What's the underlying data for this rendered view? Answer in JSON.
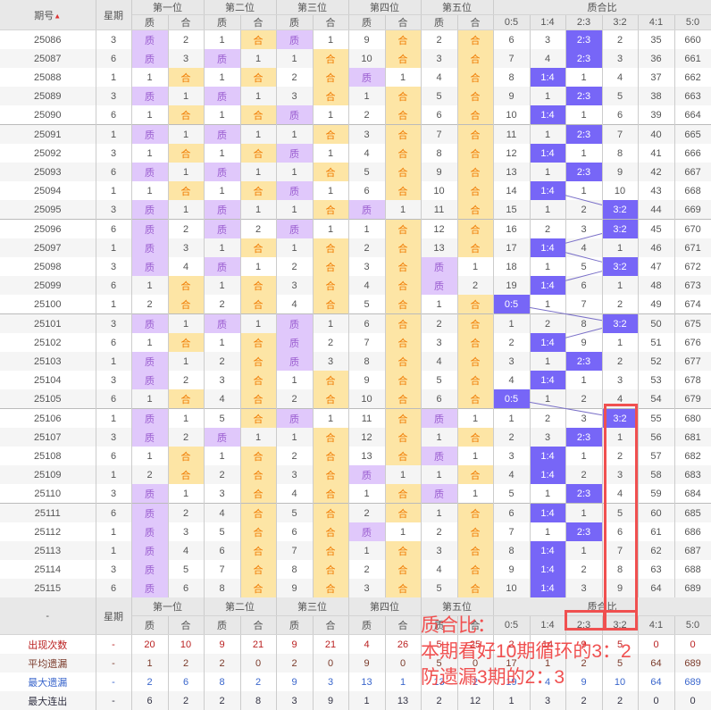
{
  "header": {
    "issue_label": "期号",
    "weekday_label": "星期",
    "positions": [
      "第一位",
      "第二位",
      "第三位",
      "第四位",
      "第五位"
    ],
    "sub_labels": [
      "质",
      "合"
    ],
    "ratio_label": "质合比",
    "ratio_cols": [
      "0:5",
      "1:4",
      "2:3",
      "3:2",
      "4:1",
      "5:0"
    ],
    "footer_issue_label": "-"
  },
  "colors": {
    "zhi_bg": "#e0c8fb",
    "he_bg": "#fde5a5",
    "ratio_hit": "#7766f7",
    "annotation": "#f05050"
  },
  "rows": [
    {
      "issue": "25086",
      "wd": "3",
      "pos": [
        "质",
        "2",
        "1",
        "合",
        "质",
        "1",
        "9",
        "合",
        "2",
        "合"
      ],
      "ratio": [
        "6",
        "3",
        "2:3",
        "2",
        "35",
        "660"
      ]
    },
    {
      "issue": "25087",
      "wd": "6",
      "pos": [
        "质",
        "3",
        "质",
        "1",
        "1",
        "合",
        "10",
        "合",
        "3",
        "合"
      ],
      "ratio": [
        "7",
        "4",
        "2:3",
        "3",
        "36",
        "661"
      ]
    },
    {
      "issue": "25088",
      "wd": "1",
      "pos": [
        "1",
        "合",
        "1",
        "合",
        "2",
        "合",
        "质",
        "1",
        "4",
        "合"
      ],
      "ratio": [
        "8",
        "1:4",
        "1",
        "4",
        "37",
        "662"
      ]
    },
    {
      "issue": "25089",
      "wd": "3",
      "pos": [
        "质",
        "1",
        "质",
        "1",
        "3",
        "合",
        "1",
        "合",
        "5",
        "合"
      ],
      "ratio": [
        "9",
        "1",
        "2:3",
        "5",
        "38",
        "663"
      ]
    },
    {
      "issue": "25090",
      "wd": "6",
      "pos": [
        "1",
        "合",
        "1",
        "合",
        "质",
        "1",
        "2",
        "合",
        "6",
        "合"
      ],
      "ratio": [
        "10",
        "1:4",
        "1",
        "6",
        "39",
        "664"
      ]
    },
    {
      "issue": "25091",
      "wd": "1",
      "pos": [
        "质",
        "1",
        "质",
        "1",
        "1",
        "合",
        "3",
        "合",
        "7",
        "合"
      ],
      "ratio": [
        "11",
        "1",
        "2:3",
        "7",
        "40",
        "665"
      ]
    },
    {
      "issue": "25092",
      "wd": "3",
      "pos": [
        "1",
        "合",
        "1",
        "合",
        "质",
        "1",
        "4",
        "合",
        "8",
        "合"
      ],
      "ratio": [
        "12",
        "1:4",
        "1",
        "8",
        "41",
        "666"
      ]
    },
    {
      "issue": "25093",
      "wd": "6",
      "pos": [
        "质",
        "1",
        "质",
        "1",
        "1",
        "合",
        "5",
        "合",
        "9",
        "合"
      ],
      "ratio": [
        "13",
        "1",
        "2:3",
        "9",
        "42",
        "667"
      ]
    },
    {
      "issue": "25094",
      "wd": "1",
      "pos": [
        "1",
        "合",
        "1",
        "合",
        "质",
        "1",
        "6",
        "合",
        "10",
        "合"
      ],
      "ratio": [
        "14",
        "1:4",
        "1",
        "10",
        "43",
        "668"
      ]
    },
    {
      "issue": "25095",
      "wd": "3",
      "pos": [
        "质",
        "1",
        "质",
        "1",
        "1",
        "合",
        "质",
        "1",
        "11",
        "合"
      ],
      "ratio": [
        "15",
        "1",
        "2",
        "3:2",
        "44",
        "669"
      ]
    },
    {
      "issue": "25096",
      "wd": "6",
      "pos": [
        "质",
        "2",
        "质",
        "2",
        "质",
        "1",
        "1",
        "合",
        "12",
        "合"
      ],
      "ratio": [
        "16",
        "2",
        "3",
        "3:2",
        "45",
        "670"
      ]
    },
    {
      "issue": "25097",
      "wd": "1",
      "pos": [
        "质",
        "3",
        "1",
        "合",
        "1",
        "合",
        "2",
        "合",
        "13",
        "合"
      ],
      "ratio": [
        "17",
        "1:4",
        "4",
        "1",
        "46",
        "671"
      ]
    },
    {
      "issue": "25098",
      "wd": "3",
      "pos": [
        "质",
        "4",
        "质",
        "1",
        "2",
        "合",
        "3",
        "合",
        "质",
        "1"
      ],
      "ratio": [
        "18",
        "1",
        "5",
        "3:2",
        "47",
        "672"
      ]
    },
    {
      "issue": "25099",
      "wd": "6",
      "pos": [
        "1",
        "合",
        "1",
        "合",
        "3",
        "合",
        "4",
        "合",
        "质",
        "2"
      ],
      "ratio": [
        "19",
        "1:4",
        "6",
        "1",
        "48",
        "673"
      ]
    },
    {
      "issue": "25100",
      "wd": "1",
      "pos": [
        "2",
        "合",
        "2",
        "合",
        "4",
        "合",
        "5",
        "合",
        "1",
        "合"
      ],
      "ratio": [
        "0:5",
        "1",
        "7",
        "2",
        "49",
        "674"
      ]
    },
    {
      "issue": "25101",
      "wd": "3",
      "pos": [
        "质",
        "1",
        "质",
        "1",
        "质",
        "1",
        "6",
        "合",
        "2",
        "合"
      ],
      "ratio": [
        "1",
        "2",
        "8",
        "3:2",
        "50",
        "675"
      ]
    },
    {
      "issue": "25102",
      "wd": "6",
      "pos": [
        "1",
        "合",
        "1",
        "合",
        "质",
        "2",
        "7",
        "合",
        "3",
        "合"
      ],
      "ratio": [
        "2",
        "1:4",
        "9",
        "1",
        "51",
        "676"
      ]
    },
    {
      "issue": "25103",
      "wd": "1",
      "pos": [
        "质",
        "1",
        "2",
        "合",
        "质",
        "3",
        "8",
        "合",
        "4",
        "合"
      ],
      "ratio": [
        "3",
        "1",
        "2:3",
        "2",
        "52",
        "677"
      ]
    },
    {
      "issue": "25104",
      "wd": "3",
      "pos": [
        "质",
        "2",
        "3",
        "合",
        "1",
        "合",
        "9",
        "合",
        "5",
        "合"
      ],
      "ratio": [
        "4",
        "1:4",
        "1",
        "3",
        "53",
        "678"
      ]
    },
    {
      "issue": "25105",
      "wd": "6",
      "pos": [
        "1",
        "合",
        "4",
        "合",
        "2",
        "合",
        "10",
        "合",
        "6",
        "合"
      ],
      "ratio": [
        "0:5",
        "1",
        "2",
        "4",
        "54",
        "679"
      ]
    },
    {
      "issue": "25106",
      "wd": "1",
      "pos": [
        "质",
        "1",
        "5",
        "合",
        "质",
        "1",
        "11",
        "合",
        "质",
        "1"
      ],
      "ratio": [
        "1",
        "2",
        "3",
        "3:2",
        "55",
        "680"
      ]
    },
    {
      "issue": "25107",
      "wd": "3",
      "pos": [
        "质",
        "2",
        "质",
        "1",
        "1",
        "合",
        "12",
        "合",
        "1",
        "合"
      ],
      "ratio": [
        "2",
        "3",
        "2:3",
        "1",
        "56",
        "681"
      ]
    },
    {
      "issue": "25108",
      "wd": "6",
      "pos": [
        "1",
        "合",
        "1",
        "合",
        "2",
        "合",
        "13",
        "合",
        "质",
        "1"
      ],
      "ratio": [
        "3",
        "1:4",
        "1",
        "2",
        "57",
        "682"
      ]
    },
    {
      "issue": "25109",
      "wd": "1",
      "pos": [
        "2",
        "合",
        "2",
        "合",
        "3",
        "合",
        "质",
        "1",
        "1",
        "合"
      ],
      "ratio": [
        "4",
        "1:4",
        "2",
        "3",
        "58",
        "683"
      ]
    },
    {
      "issue": "25110",
      "wd": "3",
      "pos": [
        "质",
        "1",
        "3",
        "合",
        "4",
        "合",
        "1",
        "合",
        "质",
        "1"
      ],
      "ratio": [
        "5",
        "1",
        "2:3",
        "4",
        "59",
        "684"
      ]
    },
    {
      "issue": "25111",
      "wd": "6",
      "pos": [
        "质",
        "2",
        "4",
        "合",
        "5",
        "合",
        "2",
        "合",
        "1",
        "合"
      ],
      "ratio": [
        "6",
        "1:4",
        "1",
        "5",
        "60",
        "685"
      ]
    },
    {
      "issue": "25112",
      "wd": "1",
      "pos": [
        "质",
        "3",
        "5",
        "合",
        "6",
        "合",
        "质",
        "1",
        "2",
        "合"
      ],
      "ratio": [
        "7",
        "1",
        "2:3",
        "6",
        "61",
        "686"
      ]
    },
    {
      "issue": "25113",
      "wd": "1",
      "pos": [
        "质",
        "4",
        "6",
        "合",
        "7",
        "合",
        "1",
        "合",
        "3",
        "合"
      ],
      "ratio": [
        "8",
        "1:4",
        "1",
        "7",
        "62",
        "687"
      ]
    },
    {
      "issue": "25114",
      "wd": "3",
      "pos": [
        "质",
        "5",
        "7",
        "合",
        "8",
        "合",
        "2",
        "合",
        "4",
        "合"
      ],
      "ratio": [
        "9",
        "1:4",
        "2",
        "8",
        "63",
        "688"
      ]
    },
    {
      "issue": "25115",
      "wd": "6",
      "pos": [
        "质",
        "6",
        "8",
        "合",
        "9",
        "合",
        "3",
        "合",
        "5",
        "合"
      ],
      "ratio": [
        "10",
        "1:4",
        "3",
        "9",
        "64",
        "689"
      ]
    }
  ],
  "stats": [
    {
      "label": "出现次数",
      "wd": "-",
      "values": [
        "20",
        "10",
        "9",
        "21",
        "9",
        "21",
        "4",
        "26",
        "5",
        "25",
        "2",
        "14",
        "9",
        "5",
        "0",
        "0"
      ]
    },
    {
      "label": "平均遗漏",
      "wd": "-",
      "values": [
        "1",
        "2",
        "2",
        "0",
        "2",
        "0",
        "9",
        "0",
        "5",
        "0",
        "17",
        "1",
        "2",
        "5",
        "64",
        "689"
      ]
    },
    {
      "label": "最大遗漏",
      "wd": "-",
      "values": [
        "2",
        "6",
        "8",
        "2",
        "9",
        "3",
        "13",
        "1",
        "13",
        "2",
        "19",
        "4",
        "9",
        "10",
        "64",
        "689"
      ]
    },
    {
      "label": "最大连出",
      "wd": "-",
      "values": [
        "6",
        "2",
        "2",
        "8",
        "3",
        "9",
        "1",
        "13",
        "2",
        "12",
        "1",
        "3",
        "2",
        "2",
        "0",
        "0"
      ]
    }
  ],
  "annotation": {
    "lines": [
      "质合比：",
      "本期看好10期循环的3：2",
      "防遗漏3期的2：3"
    ]
  }
}
